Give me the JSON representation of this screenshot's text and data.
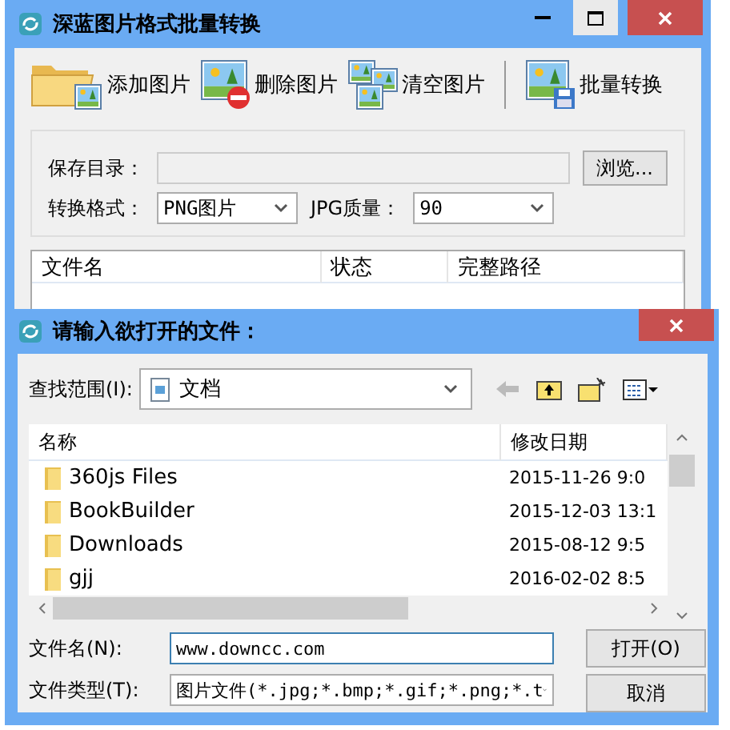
{
  "window": {
    "title": "深蓝图片格式批量转换"
  },
  "toolbar": [
    {
      "kind": "add",
      "label": "添加图片"
    },
    {
      "kind": "delete",
      "label": "删除图片"
    },
    {
      "kind": "clear",
      "label": "清空图片"
    },
    {
      "kind": "convert",
      "label": "批量转换"
    }
  ],
  "settings": {
    "save_dir_label": "保存目录：",
    "browse_button": "浏览...",
    "format_label": "转换格式：",
    "format_value": "PNG图片",
    "quality_label": "JPG质量：",
    "quality_value": "90"
  },
  "file_table": {
    "columns": [
      "文件名",
      "状态",
      "完整路径"
    ]
  },
  "dialog": {
    "title": "请输入欲打开的文件：",
    "look_in_label": "查找范围(I):",
    "look_in_value": "文档",
    "columns": [
      "名称",
      "修改日期"
    ],
    "rows": [
      {
        "name": "360js Files",
        "modified": "2015-11-26 9:0"
      },
      {
        "name": "BookBuilder",
        "modified": "2015-12-03 13:1"
      },
      {
        "name": "Downloads",
        "modified": "2015-08-12 9:5"
      },
      {
        "name": "gjj",
        "modified": "2016-02-02 8:5"
      }
    ],
    "file_name_label": "文件名(N):",
    "file_name_value": "www.downcc.com",
    "file_type_label": "文件类型(T):",
    "file_type_value": "图片文件(*.jpg;*.bmp;*.gif;*.png;*.t",
    "open_button": "打开(O)",
    "cancel_button": "取消"
  }
}
